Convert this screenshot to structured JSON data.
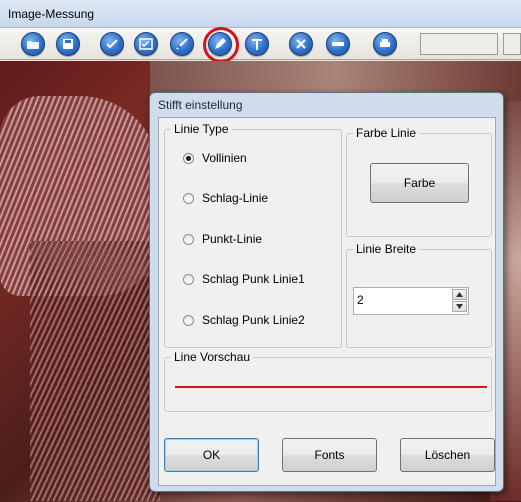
{
  "window": {
    "title": "Image-Messung"
  },
  "toolbar": {
    "buttons": [
      {
        "name": "open-icon"
      },
      {
        "name": "save-icon"
      },
      {
        "name": "check-icon"
      },
      {
        "name": "image-check-icon"
      },
      {
        "name": "measure-icon"
      },
      {
        "name": "pen-icon"
      },
      {
        "name": "text-icon"
      },
      {
        "name": "delete-icon"
      },
      {
        "name": "info-icon"
      },
      {
        "name": "print-icon"
      }
    ]
  },
  "dialog": {
    "title": "Stifft einstellung",
    "line_type": {
      "label": "Linie Type",
      "options": [
        "Vollinien",
        "Schlag-Linie",
        "Punkt-Linie",
        "Schlag Punk Linie1",
        "Schlag Punk Linie2"
      ],
      "selected": "Vollinien"
    },
    "line_color": {
      "label": "Farbe Linie",
      "button": "Farbe",
      "color": "#cc1a1a"
    },
    "line_width": {
      "label": "Linie Breite",
      "value": "2"
    },
    "preview": {
      "label": "Line Vorschau"
    },
    "buttons": {
      "ok": "OK",
      "fonts": "Fonts",
      "delete": "Löschen"
    }
  },
  "colors": {
    "highlight": "#d1121b",
    "preview_line": "#cc1a1a"
  }
}
